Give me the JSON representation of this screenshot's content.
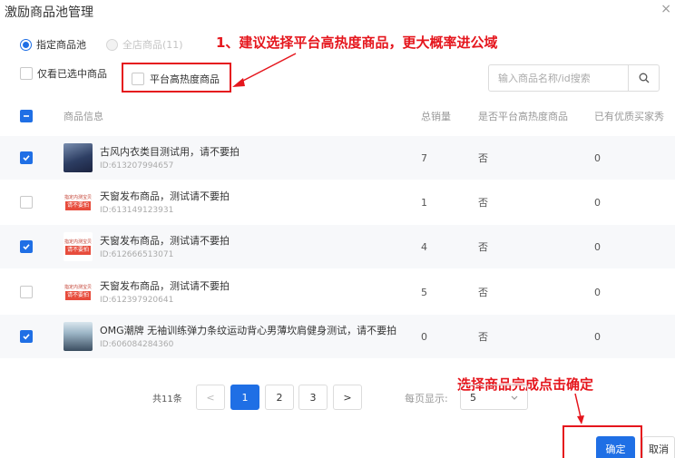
{
  "dialog": {
    "title": "激励商品池管理",
    "close": "×"
  },
  "scope": {
    "options": [
      {
        "label": "指定商品池",
        "selected": true,
        "disabled": false
      },
      {
        "label": "全店商品(11)",
        "selected": false,
        "disabled": true
      }
    ]
  },
  "annotations": {
    "tip1": "1、建议选择平台高热度商品，更大概率进公域",
    "tip2": "选择商品完成点击确定",
    "color": "#e5161d"
  },
  "filters": {
    "only_selected": "仅看已选中商品",
    "hot_products": "平台高热度商品"
  },
  "search": {
    "placeholder": "输入商品名称/id搜索",
    "icon": "search-icon"
  },
  "table": {
    "headers": {
      "info": "商品信息",
      "sales": "总销量",
      "hot": "是否平台高热度商品",
      "buyer": "已有优质买家秀"
    },
    "rows": [
      {
        "checked": true,
        "name": "古风内衣类目测试用，请不要拍",
        "id": "ID:613207994657",
        "sales": "7",
        "hot": "否",
        "buyer": "0",
        "thumb": "photo"
      },
      {
        "checked": false,
        "name": "天窗发布商品，测试请不要拍",
        "id": "ID:613149123931",
        "sales": "1",
        "hot": "否",
        "buyer": "0",
        "thumb": "tag"
      },
      {
        "checked": true,
        "name": "天窗发布商品，测试请不要拍",
        "id": "ID:612666513071",
        "sales": "4",
        "hot": "否",
        "buyer": "0",
        "thumb": "tag"
      },
      {
        "checked": false,
        "name": "天窗发布商品，测试请不要拍",
        "id": "ID:612397920641",
        "sales": "5",
        "hot": "否",
        "buyer": "0",
        "thumb": "tag"
      },
      {
        "checked": true,
        "name": "OMG潮牌 无袖训练弹力条纹运动背心男薄坎肩健身测试，请不要拍",
        "id": "ID:606084284360",
        "sales": "0",
        "hot": "否",
        "buyer": "0",
        "thumb": "photo2"
      }
    ],
    "thumb_tag": {
      "line1": "指定内测宝贝",
      "line2": "请不要拍"
    }
  },
  "pagination": {
    "total": "共11条",
    "prev": "<",
    "pages": [
      "1",
      "2",
      "3"
    ],
    "current": "1",
    "next": ">",
    "page_size_label": "每页显示:",
    "page_size": "5"
  },
  "footer": {
    "confirm": "确定",
    "cancel": "取消"
  },
  "colors": {
    "primary": "#1f6fe5",
    "annotation": "#e5161d"
  }
}
